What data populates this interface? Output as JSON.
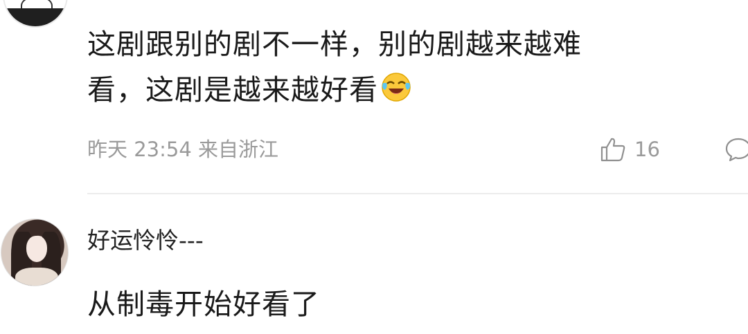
{
  "comments": [
    {
      "text_lines": [
        "这剧跟别的剧不一样，别的剧越来越难",
        "看，这剧是越来越好看"
      ],
      "emoji": "laughing-crying-emoji",
      "time": "昨天 23:54",
      "location": "来自浙江",
      "meta": "昨天 23:54 来自浙江",
      "likes": "16"
    },
    {
      "username": "好运怜怜---",
      "text": "从制毒开始好看了"
    }
  ],
  "icons": {
    "like": "thumbs-up-icon",
    "reply": "comment-bubble-icon"
  },
  "colors": {
    "text": "#1a1a1a",
    "meta": "#9a9a9a",
    "divider": "#ececec",
    "background": "#ffffff"
  }
}
